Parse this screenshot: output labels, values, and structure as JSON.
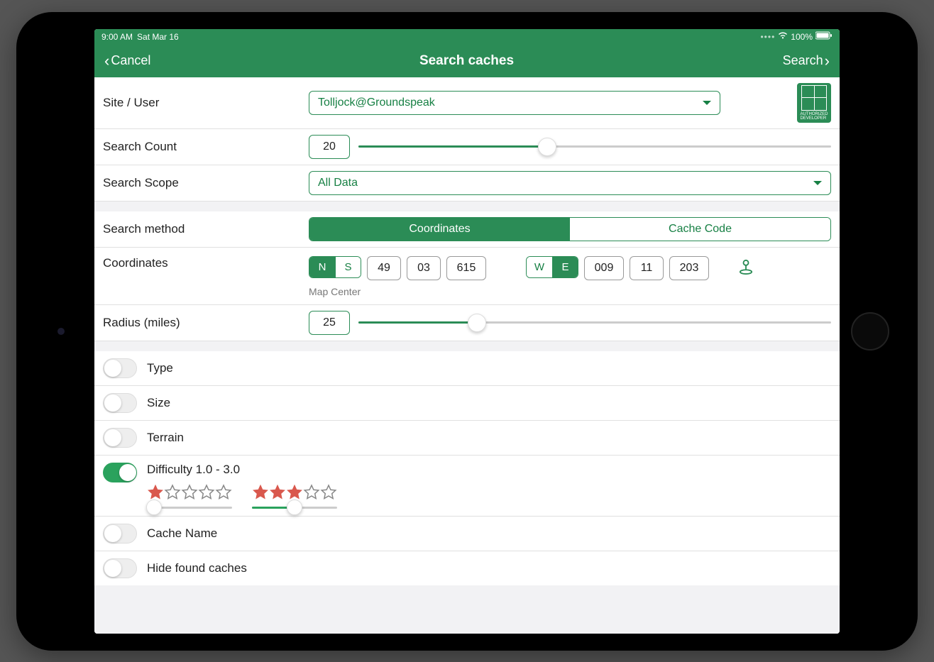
{
  "status": {
    "time": "9:00 AM",
    "date": "Sat Mar 16",
    "battery": "100%"
  },
  "nav": {
    "cancel": "Cancel",
    "title": "Search caches",
    "search": "Search"
  },
  "form": {
    "site_user_label": "Site / User",
    "site_user_value": "Tolljock@Groundspeak",
    "search_count_label": "Search Count",
    "search_count_value": "20",
    "search_count_pct": 40,
    "search_scope_label": "Search Scope",
    "search_scope_value": "All Data",
    "search_method_label": "Search method",
    "search_method_options": [
      "Coordinates",
      "Cache Code"
    ],
    "search_method_active": 0,
    "coordinates_label": "Coordinates",
    "lat_dir": [
      "N",
      "S"
    ],
    "lat_active": 0,
    "lat_deg": "49",
    "lat_min": "03",
    "lat_dec": "615",
    "lon_dir": [
      "W",
      "E"
    ],
    "lon_active": 1,
    "lon_deg": "009",
    "lon_min": "11",
    "lon_dec": "203",
    "map_center": "Map Center",
    "radius_label": "Radius (miles)",
    "radius_value": "25",
    "radius_pct": 25
  },
  "filters": {
    "type": "Type",
    "size": "Size",
    "terrain": "Terrain",
    "difficulty_label": "Difficulty 1.0 - 3.0",
    "difficulty_min_stars": 1,
    "difficulty_max_stars": 3,
    "difficulty_min_pct": 0,
    "difficulty_max_pct": 50,
    "cache_name": "Cache Name",
    "hide_found": "Hide found caches"
  },
  "colors": {
    "primary": "#2b8c56",
    "star_on": "#d9584d",
    "star_off": "#888"
  }
}
